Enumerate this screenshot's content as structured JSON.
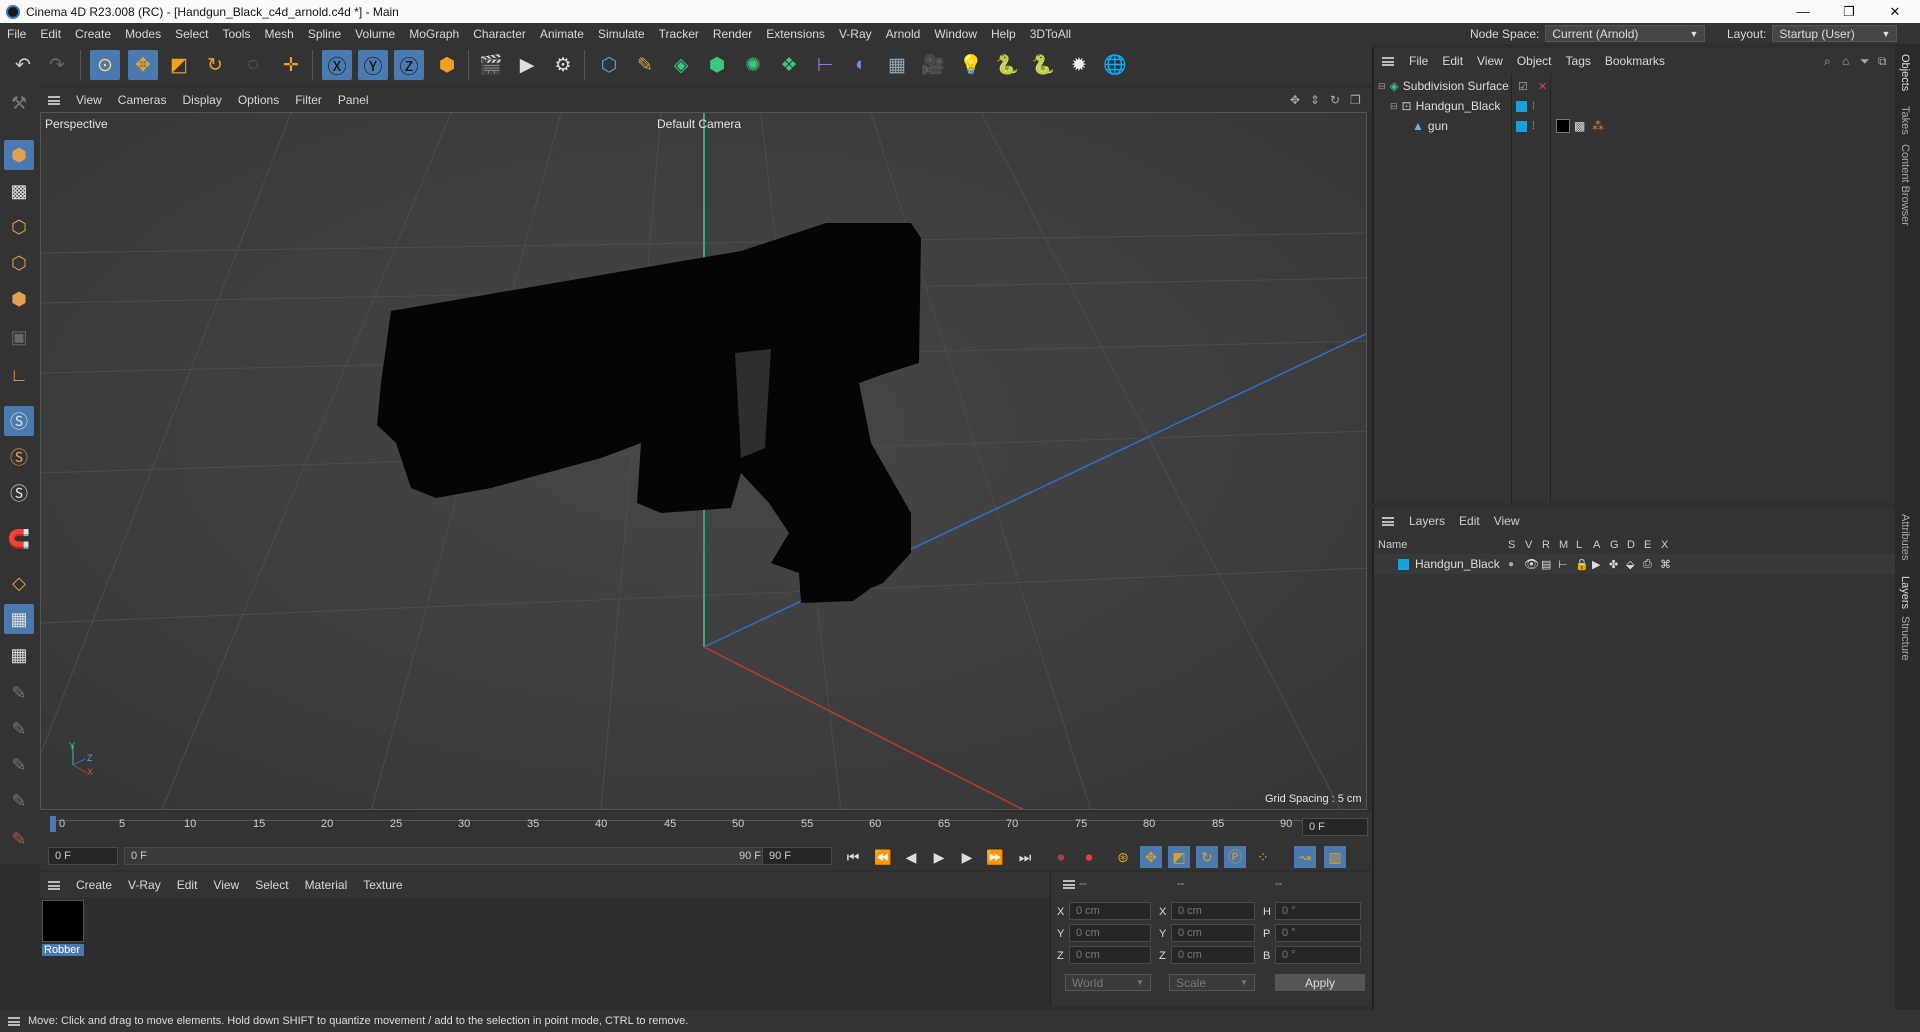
{
  "window": {
    "title": "Cinema 4D R23.008 (RC) - [Handgun_Black_c4d_arnold.c4d *] - Main",
    "minimize": "—",
    "maximize": "❐",
    "close": "✕"
  },
  "menubar": {
    "items": [
      "File",
      "Edit",
      "Create",
      "Modes",
      "Select",
      "Tools",
      "Mesh",
      "Spline",
      "Volume",
      "MoGraph",
      "Character",
      "Animate",
      "Simulate",
      "Tracker",
      "Render",
      "Extensions",
      "V-Ray",
      "Arnold",
      "Window",
      "Help",
      "3DToAll"
    ],
    "node_space_label": "Node Space:",
    "node_space_value": "Current (Arnold)",
    "layout_label": "Layout:",
    "layout_value": "Startup (User)"
  },
  "viewport": {
    "menu": [
      "View",
      "Cameras",
      "Display",
      "Options",
      "Filter",
      "Panel"
    ],
    "view_name": "Perspective",
    "camera": "Default Camera",
    "grid_spacing": "Grid Spacing : 5 cm",
    "axis_y": "Y",
    "axis_z": "Z",
    "axis_x": "X"
  },
  "timeline": {
    "ticks": [
      "0",
      "5",
      "10",
      "15",
      "20",
      "25",
      "30",
      "35",
      "40",
      "45",
      "50",
      "55",
      "60",
      "65",
      "70",
      "75",
      "80",
      "85",
      "90"
    ],
    "current_frame": "0 F"
  },
  "playbar": {
    "start": "0 F",
    "range_start": "0 F",
    "range_end": "90 F",
    "end": "90 F"
  },
  "material_manager": {
    "menu": [
      "Create",
      "V-Ray",
      "Edit",
      "View",
      "Select",
      "Material",
      "Texture"
    ],
    "materials": [
      {
        "name": "Robber",
        "color": "#000000"
      }
    ]
  },
  "coordinates": {
    "header": [
      "--",
      "--",
      "--"
    ],
    "rows": [
      {
        "axis": "X",
        "pos": "0 cm",
        "size_axis": "X",
        "size": "0 cm",
        "rot_axis": "H",
        "rot": "0 °"
      },
      {
        "axis": "Y",
        "pos": "0 cm",
        "size_axis": "Y",
        "size": "0 cm",
        "rot_axis": "P",
        "rot": "0 °"
      },
      {
        "axis": "Z",
        "pos": "0 cm",
        "size_axis": "Z",
        "size": "0 cm",
        "rot_axis": "B",
        "rot": "0 °"
      }
    ],
    "space": "World",
    "mode": "Scale",
    "apply": "Apply"
  },
  "object_manager": {
    "menu": [
      "File",
      "Edit",
      "View",
      "Object",
      "Tags",
      "Bookmarks"
    ],
    "objects": [
      {
        "name": "Subdivision Surface",
        "icon": "subdivision-icon"
      },
      {
        "name": "Handgun_Black",
        "icon": "null-object-icon"
      },
      {
        "name": "gun",
        "icon": "polygon-object-icon"
      }
    ]
  },
  "layer_manager": {
    "menu": [
      "Layers",
      "Edit",
      "View"
    ],
    "columns": [
      "Name",
      "S",
      "V",
      "R",
      "M",
      "L",
      "A",
      "G",
      "D",
      "E",
      "X"
    ],
    "layers": [
      {
        "name": "Handgun_Black",
        "color": "#1aa0d8"
      }
    ]
  },
  "side_tabs": [
    "Objects",
    "Takes",
    "Content Browser",
    "Attributes",
    "Layers",
    "Structure"
  ],
  "status": "Move: Click and drag to move elements. Hold down SHIFT to quantize movement / add to the selection in point mode, CTRL to remove.",
  "colors": {
    "accent": "#3a7fd0",
    "layer_blue": "#1aa0d8",
    "x_axis": "#c0392b",
    "y_axis": "#2ecc71",
    "z_axis": "#2e6fd0"
  }
}
